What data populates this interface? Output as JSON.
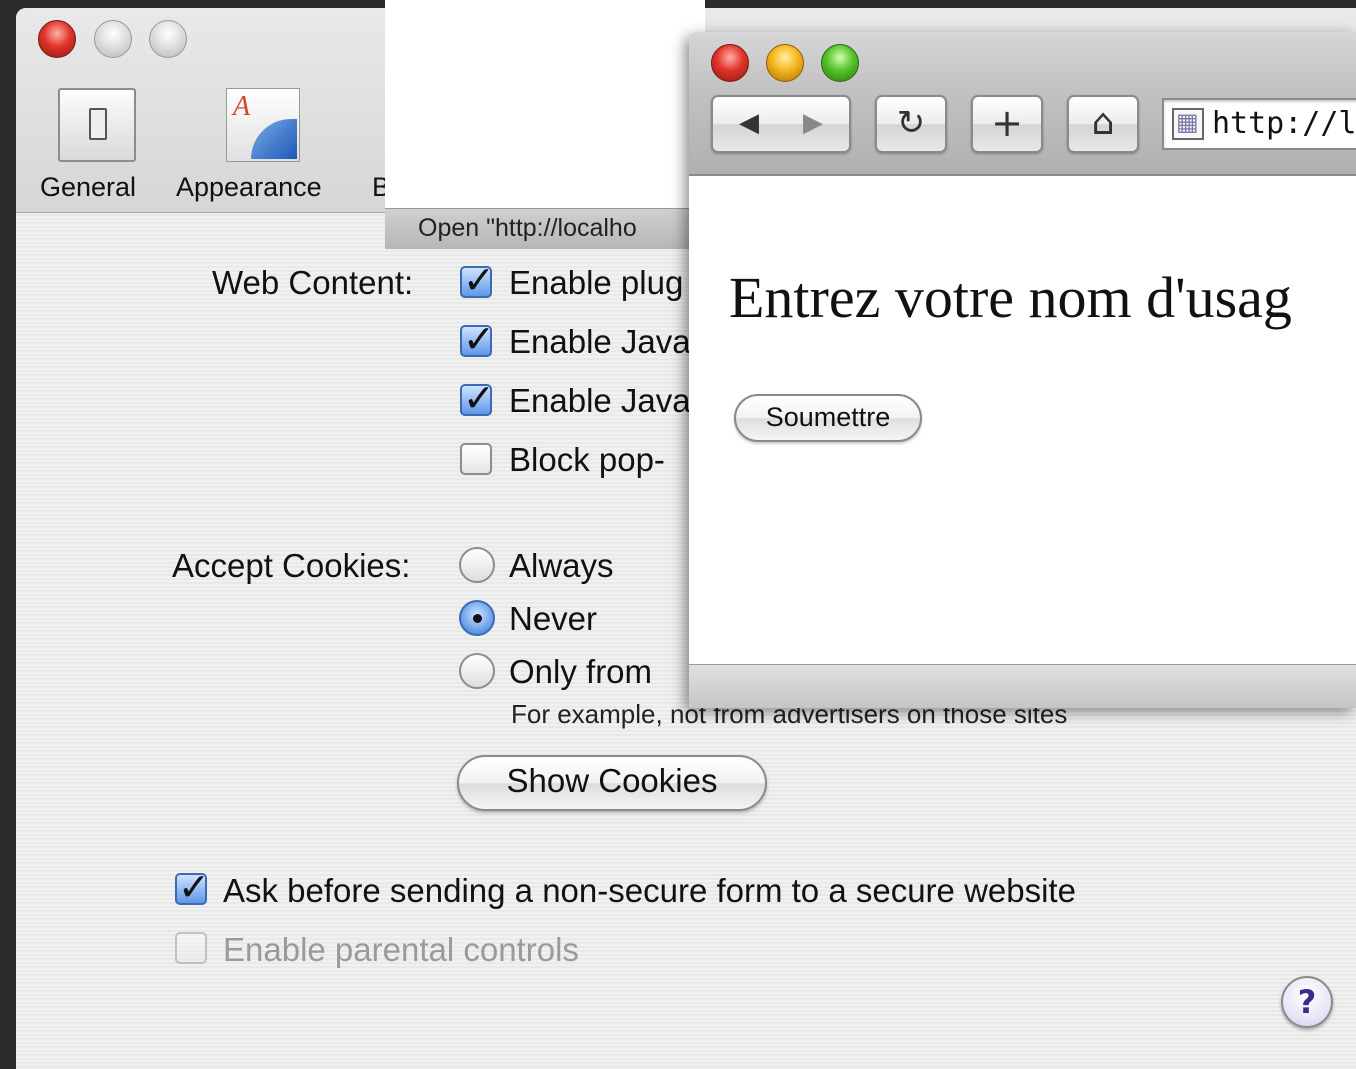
{
  "prefs": {
    "toolbar": {
      "general_label": "General",
      "appearance_label": "Appearance",
      "bookmarks_label_partial": "B"
    },
    "web_content": {
      "label": "Web Content:",
      "options": [
        {
          "label": "Enable plug",
          "checked": true
        },
        {
          "label": "Enable Java",
          "checked": true
        },
        {
          "label": "Enable Java",
          "checked": true
        },
        {
          "label": "Block pop-",
          "checked": false
        }
      ]
    },
    "cookies": {
      "label": "Accept Cookies:",
      "options": [
        {
          "label": "Always",
          "selected": false
        },
        {
          "label": "Never",
          "selected": true
        },
        {
          "label": "Only from",
          "selected": false
        }
      ],
      "note": "For example, not from advertisers on those sites",
      "show_button": "Show Cookies"
    },
    "ask_secure_form": {
      "label": "Ask before sending a non-secure form to a secure website",
      "checked": true
    },
    "parental_controls": {
      "label": "Enable parental controls",
      "checked": false,
      "disabled": true
    },
    "help_symbol": "?"
  },
  "sheet": {
    "title_partial": "Open \"http://localho"
  },
  "browser": {
    "url_partial": "http://loc",
    "heading_partial": "Entrez votre nom d'usag",
    "submit_label": "Soumettre",
    "nav": {
      "back_symbol": "◀",
      "forward_symbol": "▶",
      "reload_symbol": "↻",
      "add_symbol": "+",
      "home_symbol": "⌂"
    }
  },
  "colors": {
    "checkbox_blue": "#5f97e6",
    "close_red": "#e0332a",
    "minimize_yellow": "#f4b51c",
    "zoom_green": "#57c22a"
  }
}
